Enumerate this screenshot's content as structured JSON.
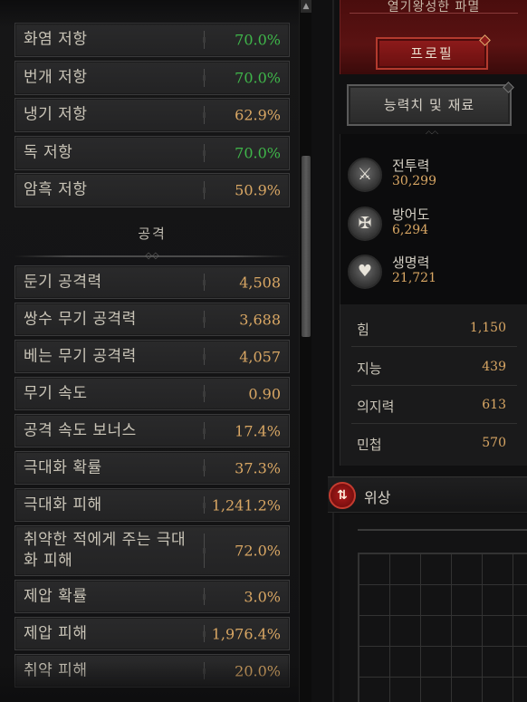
{
  "left": {
    "rows_top": [
      {
        "label": "화염 저항",
        "value": "70.0%",
        "color": "green"
      },
      {
        "label": "번개 저항",
        "value": "70.0%",
        "color": "green"
      },
      {
        "label": "냉기 저항",
        "value": "62.9%",
        "color": "gold"
      },
      {
        "label": "독 저항",
        "value": "70.0%",
        "color": "green"
      },
      {
        "label": "암흑 저항",
        "value": "50.9%",
        "color": "gold"
      }
    ],
    "section_title": "공격",
    "rows_attack": [
      {
        "label": "둔기 공격력",
        "value": "4,508",
        "color": "gold"
      },
      {
        "label": "쌍수 무기 공격력",
        "value": "3,688",
        "color": "gold"
      },
      {
        "label": "베는 무기 공격력",
        "value": "4,057",
        "color": "gold"
      },
      {
        "label": "무기 속도",
        "value": "0.90",
        "color": "gold"
      },
      {
        "label": "공격 속도 보너스",
        "value": "17.4%",
        "color": "gold"
      },
      {
        "label": "극대화 확률",
        "value": "37.3%",
        "color": "gold"
      },
      {
        "label": "극대화 피해",
        "value": "1,241.2%",
        "color": "gold"
      },
      {
        "label": "취약한 적에게 주는 극대화 피해",
        "value": "72.0%",
        "color": "gold"
      },
      {
        "label": "제압 확률",
        "value": "3.0%",
        "color": "gold"
      },
      {
        "label": "제압 피해",
        "value": "1,976.4%",
        "color": "gold"
      },
      {
        "label": "취약 피해",
        "value": "20.0%",
        "color": "gold"
      }
    ]
  },
  "right": {
    "banner_text": "열기왕성한 파멸",
    "profile_button": "프로필",
    "stats_button": "능력치 및 재료",
    "core": [
      {
        "label": "전투력",
        "value": "30,299",
        "icon": "crossed-swords-icon",
        "glyph": "⚔"
      },
      {
        "label": "방어도",
        "value": "6,294",
        "icon": "shield-icon",
        "glyph": "✠"
      },
      {
        "label": "생명력",
        "value": "21,721",
        "icon": "heart-icon",
        "glyph": "♥"
      }
    ],
    "attributes": [
      {
        "label": "힘",
        "value": "1,150"
      },
      {
        "label": "지능",
        "value": "439"
      },
      {
        "label": "의지력",
        "value": "613"
      },
      {
        "label": "민첩",
        "value": "570"
      }
    ],
    "paragon_label": "위상",
    "paragon_glyph": "⇅"
  },
  "colors": {
    "gold": "#d9a764",
    "green": "#3fb64a",
    "crimson": "#8e1b1b"
  }
}
